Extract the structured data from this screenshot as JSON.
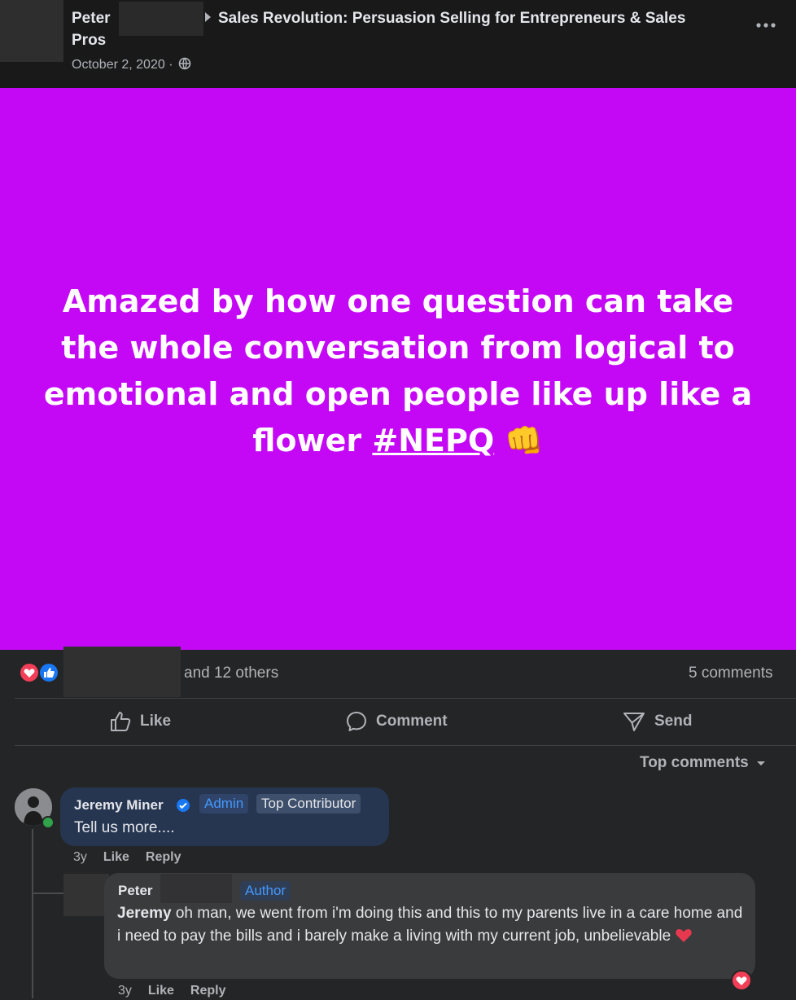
{
  "header": {
    "author_first": "Peter",
    "author_second_line": "Pros",
    "group_name": "Sales Revolution: Persuasion Selling for Entrepreneurs & Sales",
    "date": "October 2, 2020 ·",
    "more_icon": "more-horizontal-icon",
    "privacy_icon": "globe-icon"
  },
  "post": {
    "background": "#c407f5",
    "text_main": "Amazed by how one question can take the whole conversation from logical to emotional and open people like up like a flower",
    "hashtag": "#NEPQ",
    "emoji": "👊"
  },
  "reactions": {
    "icons": [
      "love-reaction-icon",
      "like-reaction-icon"
    ],
    "others_text": "and 12 others",
    "comments_count": "5 comments"
  },
  "actions": {
    "like": "Like",
    "comment": "Comment",
    "send": "Send"
  },
  "comments_section": {
    "sort_label": "Top comments"
  },
  "comments": [
    {
      "author": "Jeremy Miner",
      "badge_admin": "Admin",
      "badge_contributor": "Top Contributor",
      "text": "Tell us more....",
      "time": "3y",
      "like": "Like",
      "reply": "Reply"
    },
    {
      "author": "Peter",
      "badge_author": "Author",
      "mention": "Jeremy",
      "text": "oh man, we went from i'm doing this and this to my parents live in a care home and i need to pay the bills and i barely make a living with my current job, unbelievable",
      "time": "3y",
      "like": "Like",
      "reply": "Reply"
    }
  ],
  "colors": {
    "accent_blue": "#4599ff",
    "love_red": "#f33e58",
    "like_blue": "#1877f2"
  }
}
